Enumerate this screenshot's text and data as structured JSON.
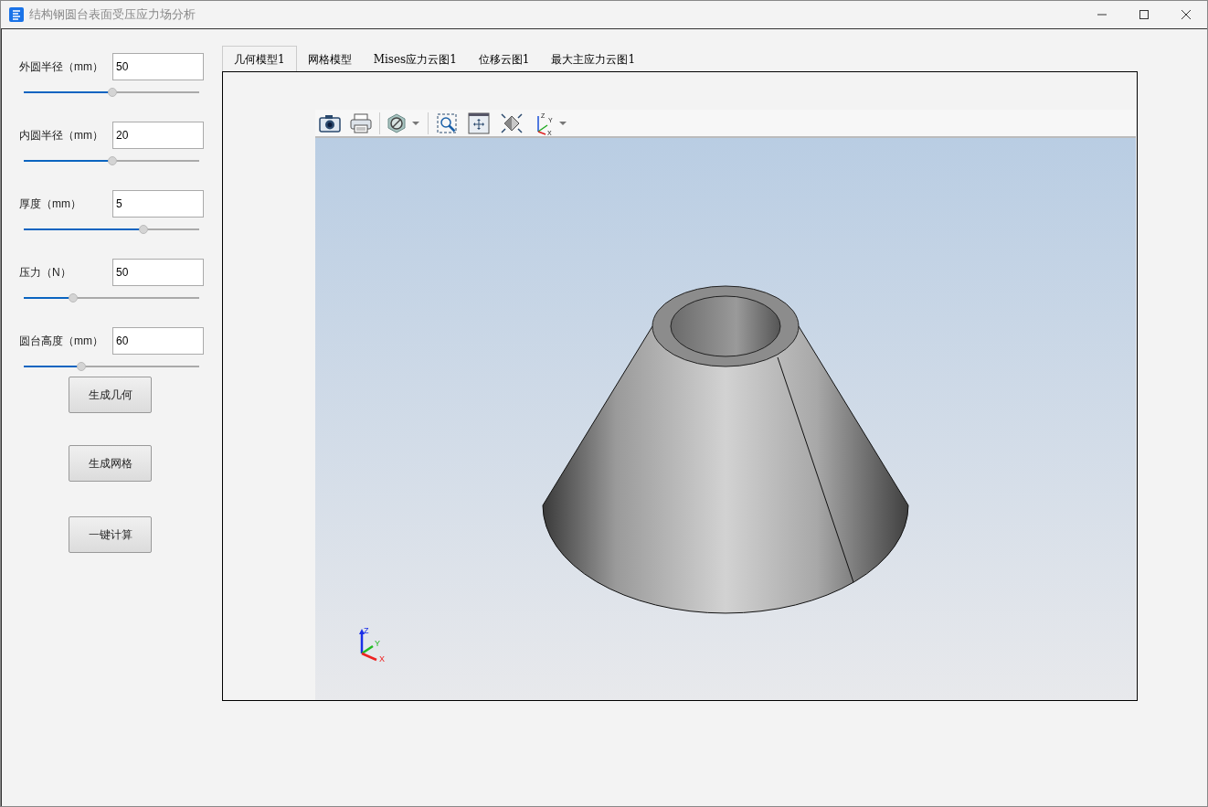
{
  "window": {
    "title": "结构钢圆台表面受压应力场分析"
  },
  "parameters": [
    {
      "label": "外圆半径（mm）",
      "value": "50",
      "level": 0.505
    },
    {
      "label": "内圆半径（mm）",
      "value": "20",
      "level": 0.505
    },
    {
      "label": "厚度（mm）",
      "value": "5",
      "level": 0.68
    },
    {
      "label": "压力（N）",
      "value": "50",
      "level": 0.28
    },
    {
      "label": "圆台高度（mm）",
      "value": "60",
      "level": 0.33
    }
  ],
  "buttons": [
    "生成几何",
    "生成网格",
    "一键计算"
  ],
  "tabs": [
    {
      "label": "几何模型1",
      "selected": true
    },
    {
      "label": "网格模型",
      "selected": false
    },
    {
      "label": "Mises应力云图1",
      "selected": false
    },
    {
      "label": "位移云图1",
      "selected": false
    },
    {
      "label": "最大主应力云图1",
      "selected": false
    }
  ],
  "viewer": {
    "toolbar_axes_labels": [
      "Z",
      "Y",
      "X"
    ],
    "triad_labels": [
      "Z",
      "Y",
      "X"
    ]
  }
}
